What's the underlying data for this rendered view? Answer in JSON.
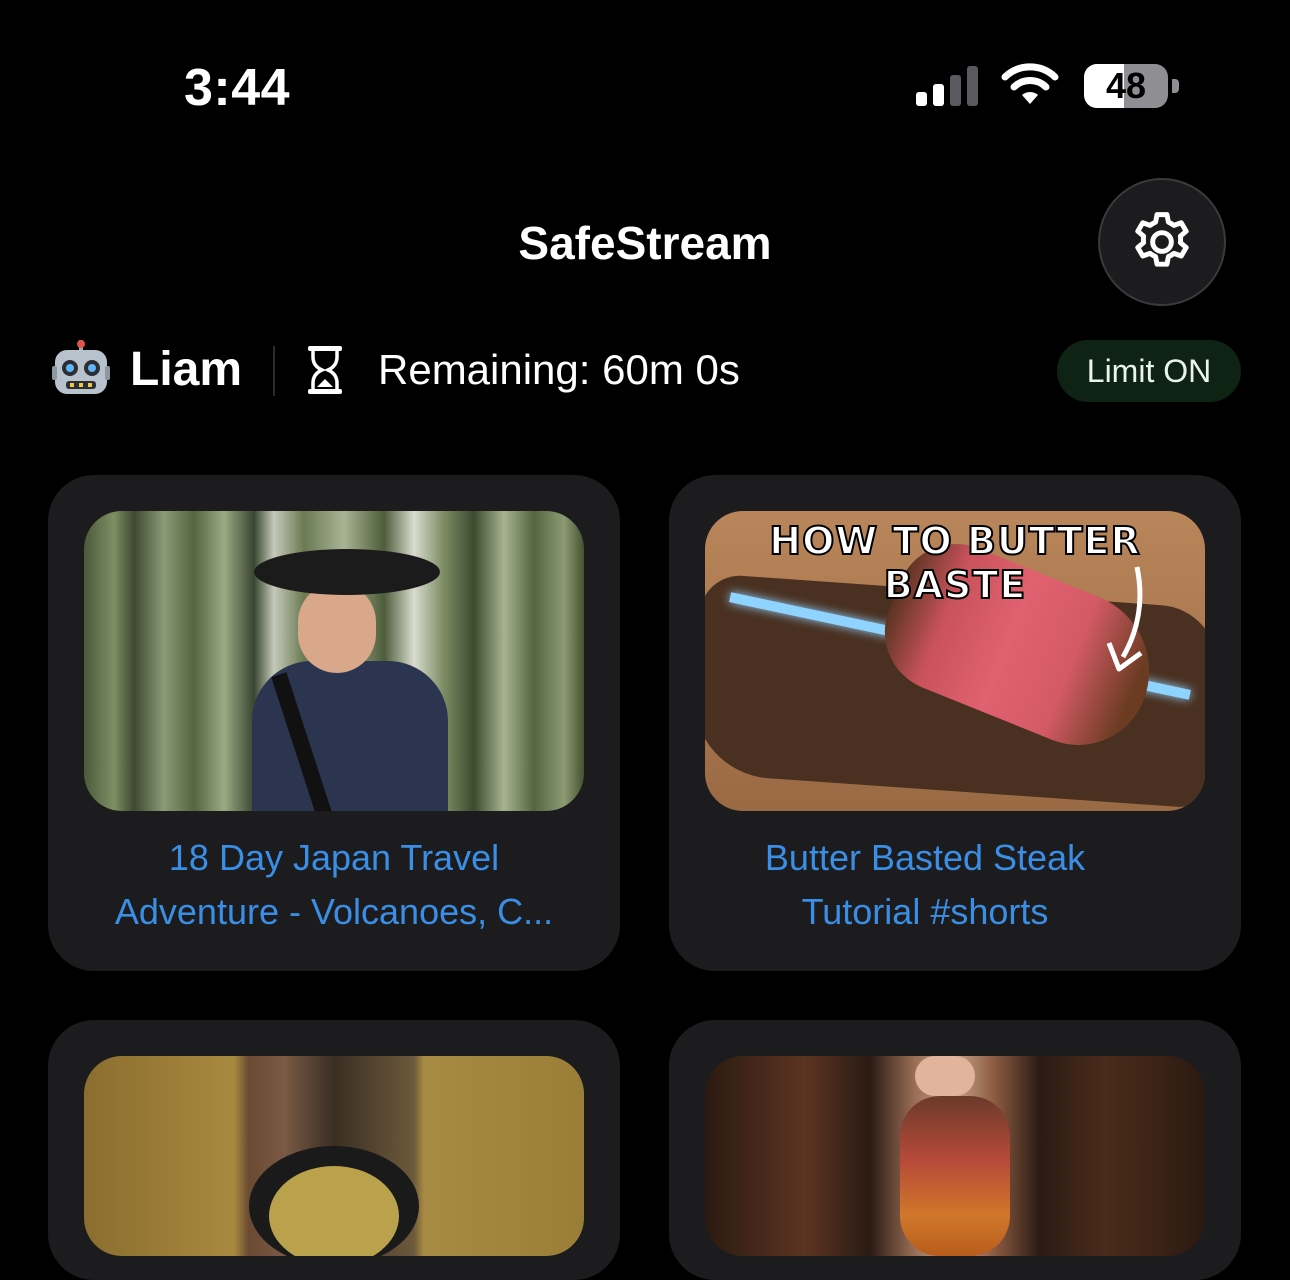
{
  "status_bar": {
    "time": "3:44",
    "battery": "48",
    "battery_level": 0.48
  },
  "header": {
    "title": "SafeStream",
    "settings_icon": "gear-icon"
  },
  "profile": {
    "avatar_icon": "robot-icon",
    "name": "Liam",
    "timer_icon": "hourglass-icon",
    "remaining": "Remaining: 60m 0s",
    "limit_badge": "Limit ON"
  },
  "videos": [
    {
      "title_line1": "18 Day Japan Travel",
      "title_line2": "Adventure - Volcanoes, C..."
    },
    {
      "title_line1": "Butter Basted Steak",
      "title_line2": "Tutorial #shorts",
      "thumbnail_text": "HOW TO BUTTER BASTE"
    },
    {
      "title_line1": "",
      "title_line2": ""
    },
    {
      "title_line1": "",
      "title_line2": ""
    }
  ],
  "colors": {
    "accent": "#3a8ee6",
    "card_bg": "#1c1c1e",
    "badge_bg": "#0f2315"
  }
}
